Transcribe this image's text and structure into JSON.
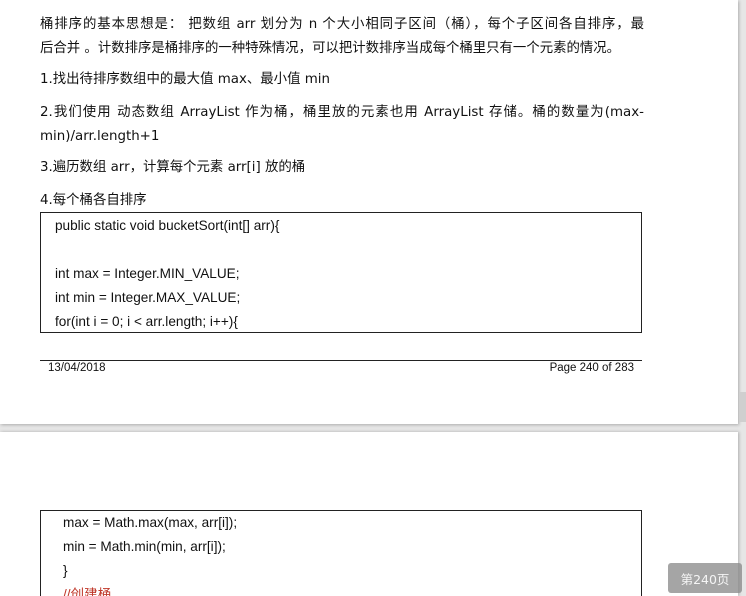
{
  "page1": {
    "paragraphs": [
      {
        "lines": [
          "桶排序的基本思想是： 把数组 arr 划分为 n 个大小相同子区间（桶），每个子区间各自排序，最",
          "后合并 。计数排序是桶排序的一种特殊情况，可以把计数排序当成每个桶里只有一个元素的情况。"
        ]
      },
      {
        "lines": [
          "1.找出待排序数组中的最大值 max、最小值 min"
        ]
      },
      {
        "lines": [
          "2.我们使用 动态数组 ArrayList 作为桶，桶里放的元素也用 ArrayList 存储。桶的数量为(max-",
          "min)/arr.length+1"
        ]
      },
      {
        "lines": [
          "3.遍历数组 arr，计算每个元素 arr[i] 放的桶"
        ]
      },
      {
        "lines": [
          "4.每个桶各自排序"
        ]
      }
    ],
    "code_lines": [
      "public static void bucketSort(int[] arr){",
      "",
      "int max = Integer.MIN_VALUE;",
      "int min = Integer.MAX_VALUE;",
      "for(int i = 0; i < arr.length; i++){"
    ],
    "footer": {
      "date": "13/04/2018",
      "page": "Page 240 of 283"
    }
  },
  "page2": {
    "code_lines": [
      "max = Math.max(max, arr[i]);",
      "min = Math.min(min, arr[i]);",
      "}",
      "//创建桶"
    ]
  },
  "page_indicator": "第240页",
  "colors": {
    "background": "#e6e6e6",
    "comment": "#c0392b"
  }
}
